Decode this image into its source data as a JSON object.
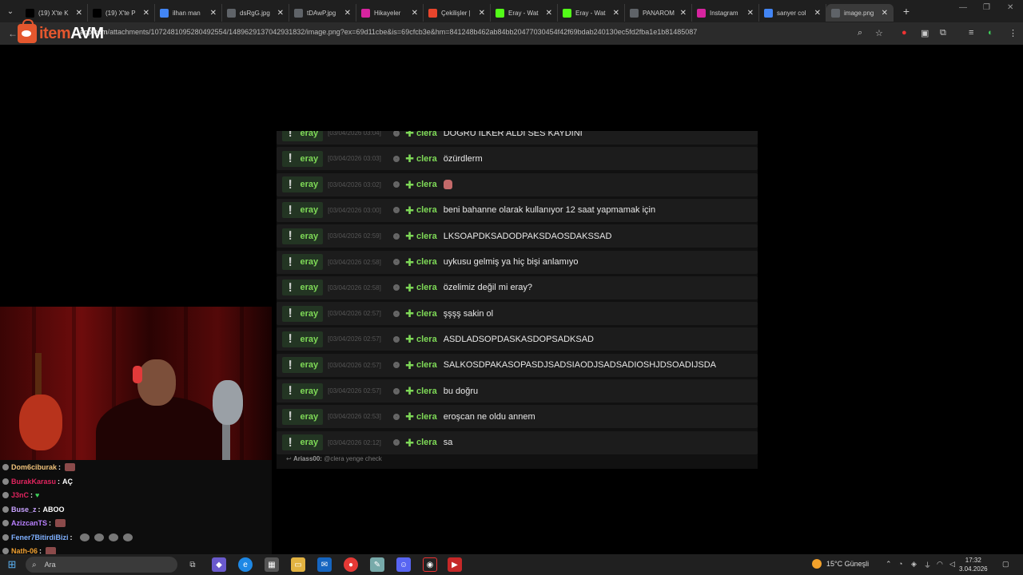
{
  "browser": {
    "tabs": [
      {
        "label": "(19) X'te K",
        "icon": "x-icon",
        "color": "#000000"
      },
      {
        "label": "(19) X'te P",
        "icon": "x-icon",
        "color": "#000000"
      },
      {
        "label": "ilhan man",
        "icon": "google-icon",
        "color": "#4285f4"
      },
      {
        "label": "dsRgG.jpg",
        "icon": "globe-icon",
        "color": "#5f6368"
      },
      {
        "label": "tDAwP.jpg",
        "icon": "globe-icon",
        "color": "#5f6368"
      },
      {
        "label": "Hikayeler",
        "icon": "instagram-icon",
        "color": "#d6249f"
      },
      {
        "label": "Çekilişler |",
        "icon": "gift-icon",
        "color": "#e8452c"
      },
      {
        "label": "Eray - Wat",
        "icon": "kick-icon",
        "color": "#53fc18"
      },
      {
        "label": "Eray - Wat",
        "icon": "kick-icon",
        "color": "#53fc18"
      },
      {
        "label": "PANAROM",
        "icon": "globe-icon",
        "color": "#5f6368"
      },
      {
        "label": "Instagram",
        "icon": "instagram-icon",
        "color": "#d6249f"
      },
      {
        "label": "sanyer col",
        "icon": "google-icon",
        "color": "#4285f4"
      },
      {
        "label": "image.png",
        "icon": "globe-icon",
        "color": "#5f6368",
        "active": true
      }
    ],
    "url_host": "app.com",
    "url_path": "/attachments/1072481095280492554/1489629137042931832/image.png?ex=69d11cbe&is=69cfcb3e&hm=841248b462ab84bb20477030454f42f69bdab240130ec5fd2fba1e1b81485087"
  },
  "logo": {
    "part1": "item",
    "part2": "AVM"
  },
  "chat": {
    "rows": [
      {
        "user": "eray",
        "time": "[03/04/2026 03:04]",
        "name": "clera",
        "text": "DOĞRU İLKER ALDI SES KAYDINI"
      },
      {
        "user": "eray",
        "time": "[03/04/2026 03:03]",
        "name": "clera",
        "text": "özürdlerm"
      },
      {
        "user": "eray",
        "time": "[03/04/2026 03:02]",
        "name": "clera",
        "text": "",
        "emote": true
      },
      {
        "user": "eray",
        "time": "[03/04/2026 03:00]",
        "name": "clera",
        "text": "beni bahanne olarak kullanıyor 12 saat yapmamak için"
      },
      {
        "user": "eray",
        "time": "[03/04/2026 02:59]",
        "name": "clera",
        "text": "LKSOAPDKSADODPAKSDAOSDAKSSAD"
      },
      {
        "user": "eray",
        "time": "[03/04/2026 02:58]",
        "name": "clera",
        "text": "uykusu gelmiş ya hiç bişi anlamıyo"
      },
      {
        "user": "eray",
        "time": "[03/04/2026 02:58]",
        "name": "clera",
        "text": "özelimiz değil mi eray?"
      },
      {
        "user": "eray",
        "time": "[03/04/2026 02:57]",
        "name": "clera",
        "text": "şşşş sakin ol"
      },
      {
        "user": "eray",
        "time": "[03/04/2026 02:57]",
        "name": "clera",
        "text": "ASDLADSOPDASKASDOPSADKSAD"
      },
      {
        "user": "eray",
        "time": "[03/04/2026 02:57]",
        "name": "clera",
        "text": "SALKOSDPAKASOPASDJSADSIAODJSADSADIOSHJDSOADIJSDA"
      },
      {
        "user": "eray",
        "time": "[03/04/2026 02:57]",
        "name": "clera",
        "text": "bu doğru"
      },
      {
        "user": "eray",
        "time": "[03/04/2026 02:53]",
        "name": "clera",
        "text": "eroşcan ne oldu annem"
      },
      {
        "user": "eray",
        "time": "[03/04/2026 02:12]",
        "name": "clera",
        "text": "sa"
      }
    ],
    "reply_name": "Ariass00:",
    "reply_text": "@clera yenge check"
  },
  "stream_chat": [
    {
      "name": "Dom6ciburak",
      "color": "#f0c27a",
      "text": "",
      "emote": "box"
    },
    {
      "name": "BurakKarasu",
      "color": "#e0245e",
      "text": "AÇ"
    },
    {
      "name": "J3nC",
      "color": "#e0245e",
      "text": "",
      "emote": "heart"
    },
    {
      "name": "Buse_z",
      "color": "#c8a2ff",
      "text": "ABOO"
    },
    {
      "name": "AzizcanTS",
      "color": "#b980ff",
      "text": "",
      "emote": "box"
    },
    {
      "name": "Fener7BitirdiBizi",
      "color": "#7fb0ff",
      "text": "",
      "emote": "multi"
    },
    {
      "name": "Nath-06",
      "color": "#f0a030",
      "text": "",
      "emote": "box"
    }
  ],
  "taskbar": {
    "search_placeholder": "Ara",
    "weather": "15°C  Güneşli",
    "time": "17:32",
    "date": "3.04.2026"
  }
}
